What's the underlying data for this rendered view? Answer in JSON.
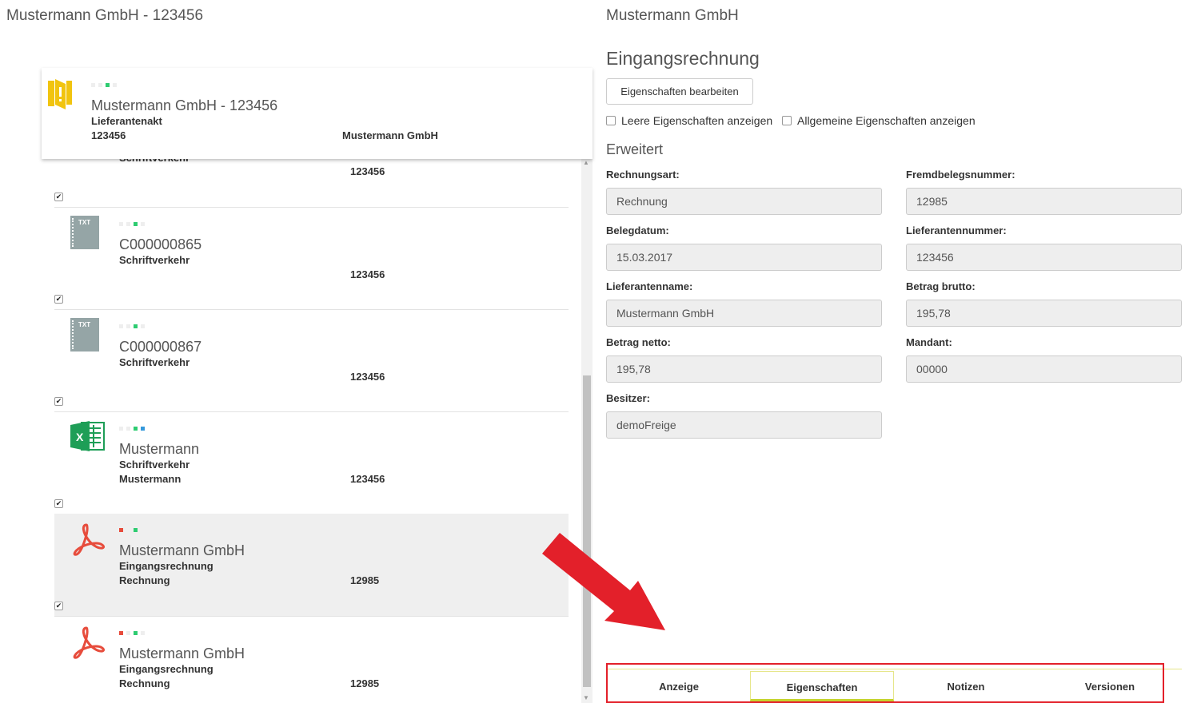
{
  "left_title": "Mustermann GmbH - 123456",
  "right_title": "Mustermann GmbH",
  "header_card": {
    "title": "Mustermann GmbH - 123456",
    "type": "Lieferantenakt",
    "id": "123456",
    "right_value": "Mustermann GmbH",
    "icon": "folder-warning-icon",
    "icon_color": "#f1c40f"
  },
  "partial_row": {
    "type": "Schriftverkehr",
    "number": "123456"
  },
  "rows": [
    {
      "icon": "txt-file-icon",
      "title": "C000000865",
      "type": "Schriftverkehr",
      "sub": "",
      "number": "123456",
      "checked": true
    },
    {
      "icon": "txt-file-icon",
      "title": "C000000867",
      "type": "Schriftverkehr",
      "sub": "",
      "number": "123456",
      "checked": true
    },
    {
      "icon": "excel-icon",
      "title": "Mustermann",
      "type": "Schriftverkehr",
      "sub": "Mustermann",
      "number": "123456",
      "checked": true
    },
    {
      "icon": "pdf-icon",
      "title": "Mustermann GmbH",
      "type": "Eingangsrechnung",
      "sub": "Rechnung",
      "number": "12985",
      "checked": true,
      "selected": true
    },
    {
      "icon": "pdf-icon",
      "title": "Mustermann GmbH",
      "type": "Eingangsrechnung",
      "sub": "Rechnung",
      "number": "12985",
      "checked": true
    }
  ],
  "properties": {
    "section_title": "Eingangsrechnung",
    "edit_button": "Eigenschaften bearbeiten",
    "show_empty": "Leere Eigenschaften anzeigen",
    "show_general": "Allgemeine Eigenschaften anzeigen",
    "extended_title": "Erweitert",
    "fields": {
      "rechnungsart": {
        "label": "Rechnungsart:",
        "value": "Rechnung"
      },
      "fremdbelegsnummer": {
        "label": "Fremdbelegsnummer:",
        "value": "12985"
      },
      "belegdatum": {
        "label": "Belegdatum:",
        "value": "15.03.2017"
      },
      "lieferantennummer": {
        "label": "Lieferantennummer:",
        "value": "123456"
      },
      "lieferantenname": {
        "label": "Lieferantenname:",
        "value": "Mustermann GmbH"
      },
      "betrag_brutto": {
        "label": "Betrag brutto:",
        "value": "195,78"
      },
      "betrag_netto": {
        "label": "Betrag netto:",
        "value": "195,78"
      },
      "mandant": {
        "label": "Mandant:",
        "value": "00000"
      },
      "besitzer": {
        "label": "Besitzer:",
        "value": "demoFreige"
      }
    }
  },
  "tabs": [
    {
      "label": "Anzeige",
      "active": false
    },
    {
      "label": "Eigenschaften",
      "active": true
    },
    {
      "label": "Notizen",
      "active": false
    },
    {
      "label": "Versionen",
      "active": false
    }
  ],
  "colors": {
    "highlight_border": "#e3202a",
    "arrow": "#e3202a",
    "active_tab_underline": "#c5d42e"
  }
}
